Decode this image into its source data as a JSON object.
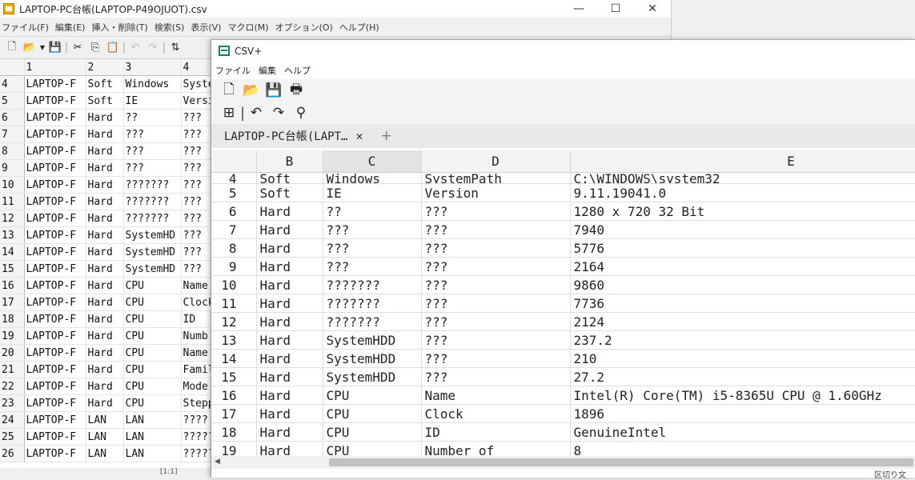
{
  "back_window": {
    "title": "LAPTOP-PC台帳(LAPTOP-P49OJUOT).csv",
    "controls": {
      "minimize": "—",
      "maximize": "☐",
      "close": "✕"
    },
    "menu": [
      "ファイル(F)",
      "編集(E)",
      "挿入・削除(T)",
      "検索(S)",
      "表示(V)",
      "マクロ(M)",
      "オプション(O)",
      "ヘルプ(H)"
    ],
    "toolbar_icons": [
      "new-file",
      "open-folder",
      "save",
      "cut",
      "copy",
      "paste",
      "undo",
      "redo",
      "sort"
    ],
    "col_headers": [
      "",
      "1",
      "2",
      "3",
      "4"
    ],
    "rows": [
      [
        "4",
        "LAPTOP-F",
        "Soft",
        "Windows",
        "Syste"
      ],
      [
        "5",
        "LAPTOP-F",
        "Soft",
        "IE",
        "Versi"
      ],
      [
        "6",
        "LAPTOP-F",
        "Hard",
        "??",
        "???"
      ],
      [
        "7",
        "LAPTOP-F",
        "Hard",
        "???",
        "???"
      ],
      [
        "8",
        "LAPTOP-F",
        "Hard",
        "???",
        "???"
      ],
      [
        "9",
        "LAPTOP-F",
        "Hard",
        "???",
        "???"
      ],
      [
        "10",
        "LAPTOP-F",
        "Hard",
        "???????",
        "???"
      ],
      [
        "11",
        "LAPTOP-F",
        "Hard",
        "???????",
        "???"
      ],
      [
        "12",
        "LAPTOP-F",
        "Hard",
        "???????",
        "???"
      ],
      [
        "13",
        "LAPTOP-F",
        "Hard",
        "SystemHD",
        "???"
      ],
      [
        "14",
        "LAPTOP-F",
        "Hard",
        "SystemHD",
        "???"
      ],
      [
        "15",
        "LAPTOP-F",
        "Hard",
        "SystemHD",
        "???"
      ],
      [
        "16",
        "LAPTOP-F",
        "Hard",
        "CPU",
        "Name"
      ],
      [
        "17",
        "LAPTOP-F",
        "Hard",
        "CPU",
        "Clock"
      ],
      [
        "18",
        "LAPTOP-F",
        "Hard",
        "CPU",
        "ID"
      ],
      [
        "19",
        "LAPTOP-F",
        "Hard",
        "CPU",
        "Numb"
      ],
      [
        "20",
        "LAPTOP-F",
        "Hard",
        "CPU",
        "Name"
      ],
      [
        "21",
        "LAPTOP-F",
        "Hard",
        "CPU",
        "Famil"
      ],
      [
        "22",
        "LAPTOP-F",
        "Hard",
        "CPU",
        "Mode"
      ],
      [
        "23",
        "LAPTOP-F",
        "Hard",
        "CPU",
        "Stepp"
      ],
      [
        "24",
        "LAPTOP-F",
        "LAN",
        "LAN",
        "????"
      ],
      [
        "25",
        "LAPTOP-F",
        "LAN",
        "LAN",
        "?????"
      ],
      [
        "26",
        "LAPTOP-F",
        "LAN",
        "LAN",
        "?????"
      ]
    ],
    "status": "[1:1]"
  },
  "front_window": {
    "title": "CSV+",
    "menu": [
      "ファイル",
      "編集",
      "ヘルプ"
    ],
    "toolbar_row1": [
      "new-file-icon",
      "open-folder-icon",
      "save-icon",
      "print-icon"
    ],
    "toolbar_row2": [
      "insert-table-icon",
      "undo-icon",
      "redo-icon",
      "search-icon"
    ],
    "tab_label": "LAPTOP-PC台帳(LAPT…",
    "tab_close": "✕",
    "tab_add": "+",
    "col_headers": [
      "",
      "B",
      "C",
      "D",
      "E"
    ],
    "rows": [
      [
        "4",
        "Soft",
        "Windows",
        "SystemPath",
        "C:\\WINDOWS\\system32"
      ],
      [
        "5",
        "Soft",
        "IE",
        "Version",
        "9.11.19041.0"
      ],
      [
        "6",
        "Hard",
        "??",
        "???",
        "1280 x 720 32 Bit"
      ],
      [
        "7",
        "Hard",
        "???",
        "???",
        "7940"
      ],
      [
        "8",
        "Hard",
        "???",
        "???",
        "5776"
      ],
      [
        "9",
        "Hard",
        "???",
        "???",
        "2164"
      ],
      [
        "10",
        "Hard",
        "???????",
        "???",
        "9860"
      ],
      [
        "11",
        "Hard",
        "???????",
        "???",
        "7736"
      ],
      [
        "12",
        "Hard",
        "???????",
        "???",
        "2124"
      ],
      [
        "13",
        "Hard",
        "SystemHDD",
        "???",
        "237.2"
      ],
      [
        "14",
        "Hard",
        "SystemHDD",
        "???",
        "210"
      ],
      [
        "15",
        "Hard",
        "SystemHDD",
        "???",
        "27.2"
      ],
      [
        "16",
        "Hard",
        "CPU",
        "Name",
        "Intel(R) Core(TM) i5-8365U CPU @ 1.60GHz"
      ],
      [
        "17",
        "Hard",
        "CPU",
        "Clock",
        "1896"
      ],
      [
        "18",
        "Hard",
        "CPU",
        "ID",
        "GenuineIntel"
      ],
      [
        "19",
        "Hard",
        "CPU",
        "Number of",
        "8"
      ]
    ],
    "status": "区切り文"
  }
}
